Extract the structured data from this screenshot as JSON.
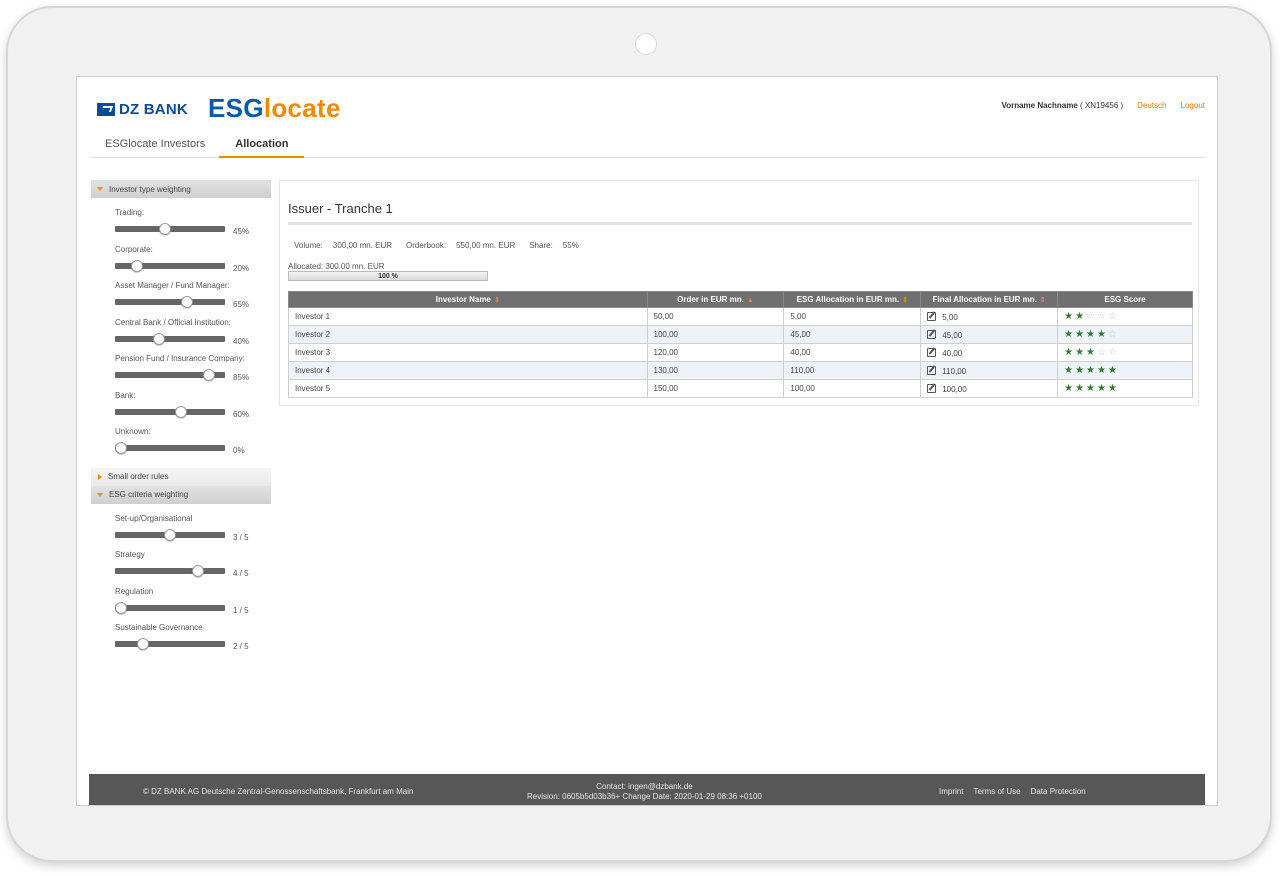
{
  "header": {
    "brand": "DZ BANK",
    "app_esg": "ESG",
    "app_locate": "locate",
    "user_name": "Vorname Nachname",
    "user_id": "( XN19456 )",
    "language_link": "Deutsch",
    "logout_link": "Logout"
  },
  "tabs": [
    {
      "label": "ESGlocate Investors",
      "active": false
    },
    {
      "label": "Allocation",
      "active": true
    }
  ],
  "sidebar": {
    "investor_section": "Investor type weighting",
    "investor_sliders": [
      {
        "label": "Trading:",
        "value": "45%",
        "level": 0.45
      },
      {
        "label": "Corporate:",
        "value": "20%",
        "level": 0.2
      },
      {
        "label": "Asset Manager / Fund Manager:",
        "value": "65%",
        "level": 0.65
      },
      {
        "label": "Central Bank / Official Institution:",
        "value": "40%",
        "level": 0.4
      },
      {
        "label": "Pension Fund / Insurance Company:",
        "value": "85%",
        "level": 0.85
      },
      {
        "label": "Bank:",
        "value": "60%",
        "level": 0.6
      },
      {
        "label": "Unknown:",
        "value": "0%",
        "level": 0.0
      }
    ],
    "small_order_section": "Small order rules",
    "esg_section": "ESG criteria weighting",
    "criteria_sliders": [
      {
        "label": "Set-up/Organisational",
        "value": "3 / 5",
        "level": 0.5
      },
      {
        "label": "Strategy",
        "value": "4 / 5",
        "level": 0.75
      },
      {
        "label": "Regulation",
        "value": "1 / 5",
        "level": 0.0
      },
      {
        "label": "Sustainable Governance",
        "value": "2 / 5",
        "level": 0.25
      }
    ]
  },
  "panel": {
    "title": "Issuer - Tranche 1",
    "volume_label": "Volume:",
    "volume_value": "300,00 mn. EUR",
    "orderbook_label": "Orderbook:",
    "orderbook_value": "550,00 mn. EUR",
    "share_label": "Share:",
    "share_value": "55%",
    "allocated_text": "Allocated: 300.00 mn. EUR",
    "allocated_pct": "100 %",
    "allocated_level": 1.0
  },
  "table": {
    "columns": [
      "Investor Name",
      "Order in EUR mn.",
      "ESG Allocation in EUR mn.",
      "Final Allocation in EUR mn.",
      "ESG Score"
    ],
    "rows": [
      {
        "name": "Investor 1",
        "order": "50,00",
        "esg": "5,00",
        "final": "5,00",
        "score": 2
      },
      {
        "name": "Investor 2",
        "order": "100,00",
        "esg": "45,00",
        "final": "45,00",
        "score": 4
      },
      {
        "name": "Investor 3",
        "order": "120,00",
        "esg": "40,00",
        "final": "40,00",
        "score": 3
      },
      {
        "name": "Investor 4",
        "order": "130,00",
        "esg": "110,00",
        "final": "110,00",
        "score": 5
      },
      {
        "name": "Investor 5",
        "order": "150,00",
        "esg": "100,00",
        "final": "100,00",
        "score": 5
      }
    ]
  },
  "footer": {
    "copyright": "© DZ BANK AG Deutsche Zentral-Genossenschaftsbank, Frankfurt am Main",
    "contact": "Contact: ingen@dzbank.de",
    "revision": "Revision: 0605b5d03b36+ Change Date: 2020-01-29 08:36 +0100",
    "links": [
      "Imprint",
      "Terms of Use",
      "Data Protection"
    ]
  },
  "colors": {
    "accent": "#f08a00",
    "brand_blue": "#0a4a9a",
    "star_green": "#2e7d32",
    "table_header": "#707070"
  }
}
